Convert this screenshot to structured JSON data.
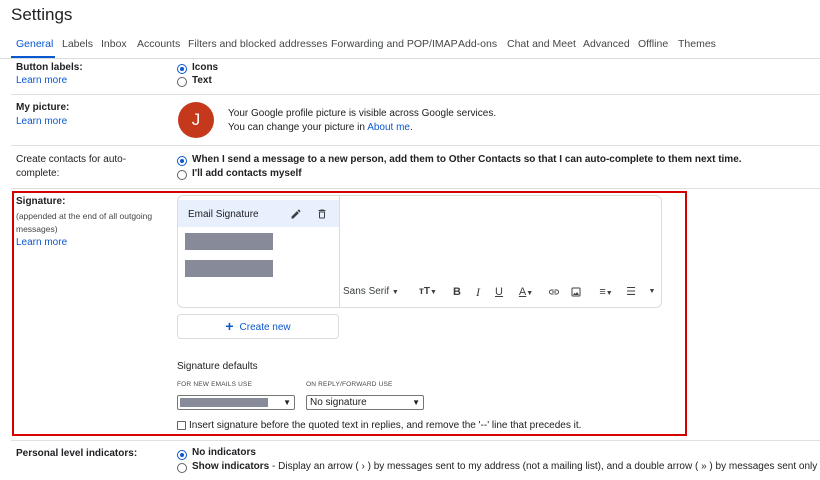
{
  "page": {
    "title": "Settings"
  },
  "tabs": [
    "General",
    "Labels",
    "Inbox",
    "Accounts",
    "Filters and blocked addresses",
    "Forwarding and POP/IMAP",
    "Add-ons",
    "Chat and Meet",
    "Advanced",
    "Offline",
    "Themes"
  ],
  "active_tab": "General",
  "button_labels": {
    "label": "Button labels:",
    "learn_more": "Learn more",
    "options": [
      "Icons",
      "Text"
    ],
    "selected": "Icons"
  },
  "my_picture": {
    "label": "My picture:",
    "learn_more": "Learn more",
    "avatar_letter": "J",
    "avatar_color": "#c5381c",
    "line1": "Your Google profile picture is visible across Google services.",
    "line2_prefix": "You can change your picture in ",
    "line2_link": "About me",
    "line2_suffix": "."
  },
  "contacts": {
    "label_line1": "Create contacts for auto-",
    "label_line2": "complete:",
    "options": [
      "When I send a message to a new person, add them to Other Contacts so that I can auto-complete to them next time.",
      "I'll add contacts myself"
    ],
    "selected": 0
  },
  "signature": {
    "label": "Signature:",
    "note_line1": "(appended at the end of all outgoing",
    "note_line2": "messages)",
    "learn_more": "Learn more",
    "selected_signature": "Email Signature",
    "edit_icon": "pencil-icon",
    "delete_icon": "trash-icon",
    "font": "Sans Serif",
    "create_new": "Create new",
    "defaults_heading": "Signature defaults",
    "new_emails_caption": "FOR NEW EMAILS USE",
    "reply_caption": "ON REPLY/FORWARD USE",
    "reply_value": "No signature",
    "insert_before": "Insert signature before the quoted text in replies, and remove the '--' line that precedes it."
  },
  "personal_indicators": {
    "label": "Personal level indicators:",
    "option1": "No indicators",
    "option2_bold": "Show indicators",
    "option2_rest": " - Display an arrow ( › ) by messages sent to my address (not a mailing list), and a double arrow ( » ) by messages sent only to me.",
    "selected": 0
  },
  "colors": {
    "accent": "#0b57d0",
    "highlight_border": "#d50000",
    "redacted": "#878b99"
  }
}
